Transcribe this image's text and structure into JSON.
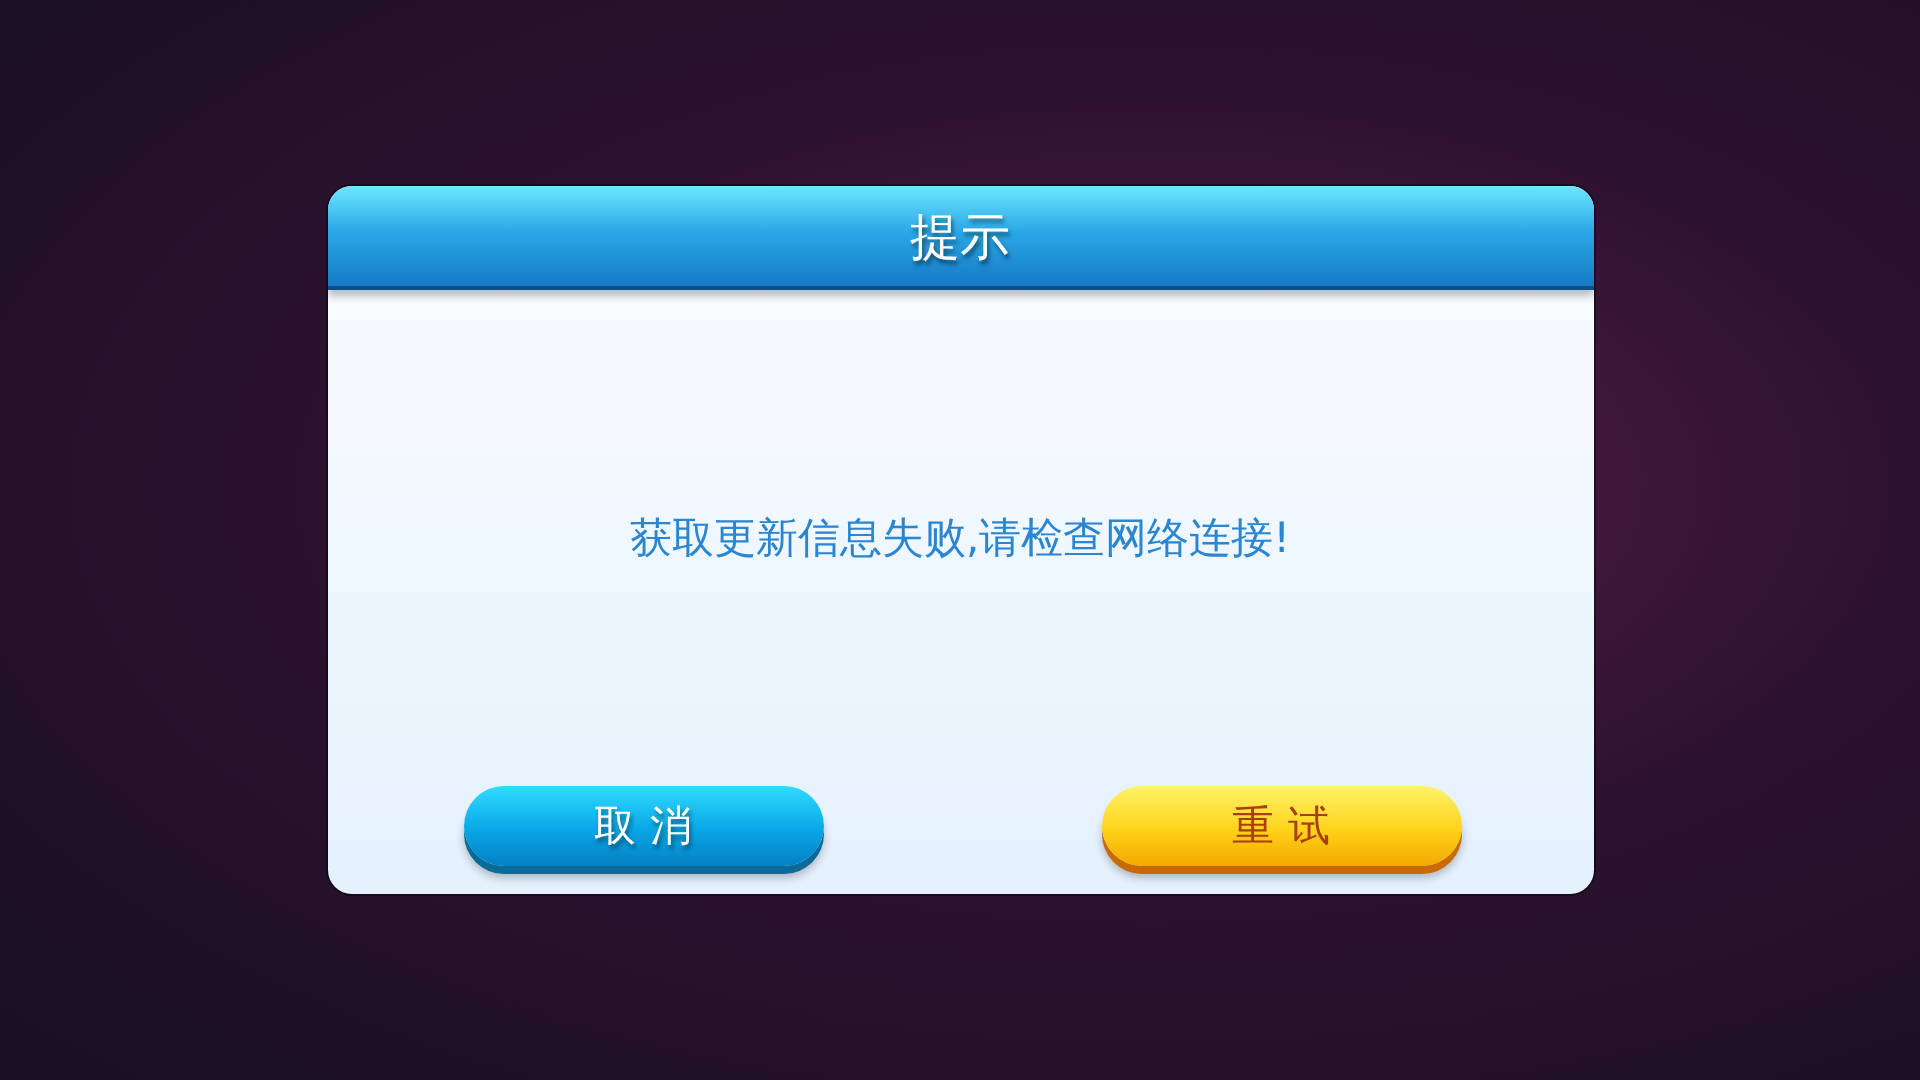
{
  "dialog": {
    "title": "提示",
    "message": "获取更新信息失败,请检查网络连接!",
    "buttons": [
      {
        "label": "取 消",
        "kind": "cancel"
      },
      {
        "label": "重 试",
        "kind": "confirm"
      }
    ]
  }
}
